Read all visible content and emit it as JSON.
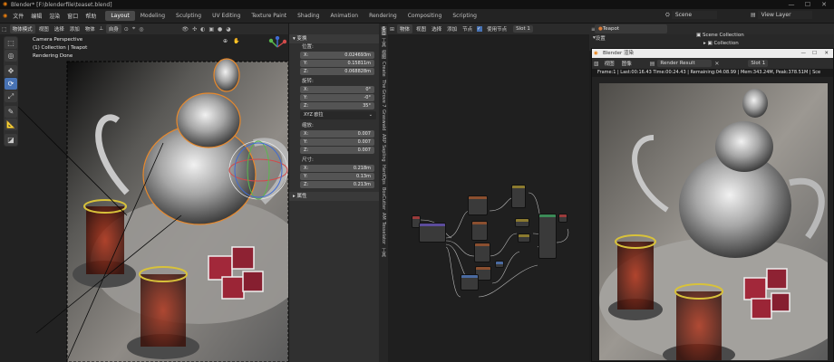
{
  "window": {
    "title": "Blender* [F:\\blenderfile\\teaset.blend]",
    "minimize": "—",
    "maximize": "☐",
    "close": "✕"
  },
  "menu": {
    "items": [
      "文件",
      "编辑",
      "渲染",
      "窗口",
      "帮助"
    ]
  },
  "workspaces": {
    "tabs": [
      "Layout",
      "Modeling",
      "Sculpting",
      "UV Editing",
      "Texture Paint",
      "Shading",
      "Animation",
      "Rendering",
      "Compositing",
      "Scripting"
    ],
    "active": "Layout"
  },
  "topright": {
    "scene_label": "Scene",
    "view_layer_label": "View Layer"
  },
  "viewport": {
    "mode": "物体模式",
    "menu": [
      "视图",
      "选择",
      "添加",
      "物体"
    ],
    "transform_orientation": "自身",
    "overlay_text": {
      "line1": "Camera Perspective",
      "line2": "(1) Collection | Teapot",
      "line3": "Rendering Done"
    },
    "tools": [
      "select-icon",
      "cursor-icon",
      "move-icon",
      "rotate-icon",
      "scale-icon",
      "annotate-icon",
      "measure-icon",
      "add-cube-icon"
    ]
  },
  "npanel": {
    "transform_header": "变换",
    "location_label": "位置:",
    "location": [
      {
        "axis": "X:",
        "value": "0.024693m"
      },
      {
        "axis": "Y:",
        "value": "0.15811m"
      },
      {
        "axis": "Z:",
        "value": "0.068828m"
      }
    ],
    "rotation_label": "旋转:",
    "rotation": [
      {
        "axis": "X:",
        "value": "0°"
      },
      {
        "axis": "Y:",
        "value": "-0°"
      },
      {
        "axis": "Z:",
        "value": "35°"
      }
    ],
    "rotation_mode": "XYZ 欧拉",
    "scale_label": "缩放:",
    "scale": [
      {
        "axis": "X:",
        "value": "0.007"
      },
      {
        "axis": "Y:",
        "value": "0.007"
      },
      {
        "axis": "Z:",
        "value": "0.007"
      }
    ],
    "dimensions_label": "尺寸:",
    "dimensions": [
      {
        "axis": "X:",
        "value": "0.218m"
      },
      {
        "axis": "Y:",
        "value": "0.13m"
      },
      {
        "axis": "Z:",
        "value": "0.213m"
      }
    ],
    "properties_header": "属性",
    "vertical_tabs": [
      "条目",
      "工具",
      "视图",
      "Create",
      "The Grove 7",
      "Graswald",
      "ARP",
      "Sapling",
      "HardOps",
      "BoxCutter",
      "AM",
      "Tesselator",
      "工具"
    ]
  },
  "node_editor": {
    "type": "物体",
    "menu": [
      "视图",
      "选择",
      "添加",
      "节点"
    ],
    "use_nodes_label": "使用节点",
    "slot": "Slot 1",
    "material": "Teapot"
  },
  "outliner": {
    "header": "设置",
    "scene_collection": "Scene Collection",
    "collection": "Collection"
  },
  "render_window": {
    "title": "Blender 渲染",
    "menu": [
      "视图",
      "图像"
    ],
    "image_name": "Render Result",
    "slot": "Slot 1",
    "info": "Frame:1 | Last:00:16.43 Time:00:24.43 | Remaining:04:08.99 | Mem:343.24M, Peak:378.51M | Sce"
  },
  "colors": {
    "accent": "#4772b3",
    "active_tab": "#4a4a4a",
    "selection_outline": "#e8892c"
  }
}
